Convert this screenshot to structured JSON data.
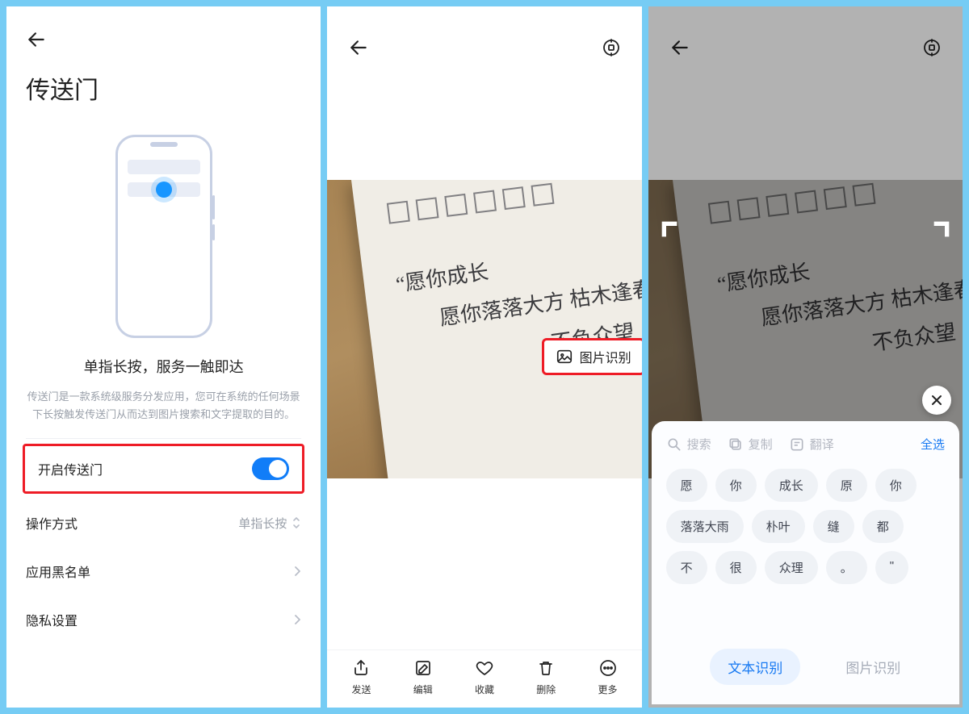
{
  "screen1": {
    "title": "传送门",
    "subtitle": "单指长按，服务一触即达",
    "description": "传送门是一款系统级服务分发应用，您可在系统的任何场景下长按触发传送门从而达到图片搜索和文字提取的目的。",
    "rows": {
      "enable_label": "开启传送门",
      "operation_label": "操作方式",
      "operation_value": "单指长按",
      "blacklist_label": "应用黑名单",
      "privacy_label": "隐私设置"
    }
  },
  "photo": {
    "line1": "愿你成长",
    "line2": "愿你落落大方  枯木逢春",
    "line3": "不负众望"
  },
  "screen2": {
    "image_recog_label": "图片识别",
    "bottom": {
      "send": "发送",
      "edit": "编辑",
      "fav": "收藏",
      "del": "删除",
      "more": "更多"
    }
  },
  "screen3": {
    "actions": {
      "search": "搜索",
      "copy": "复制",
      "translate": "翻译",
      "select_all": "全选"
    },
    "chips": [
      "愿",
      "你",
      "成长",
      "原",
      "你",
      "落落大雨",
      "朴叶",
      "缝",
      "都",
      "不",
      "很",
      "众理",
      "。",
      "\""
    ],
    "modes": {
      "text": "文本识别",
      "image": "图片识别"
    }
  }
}
